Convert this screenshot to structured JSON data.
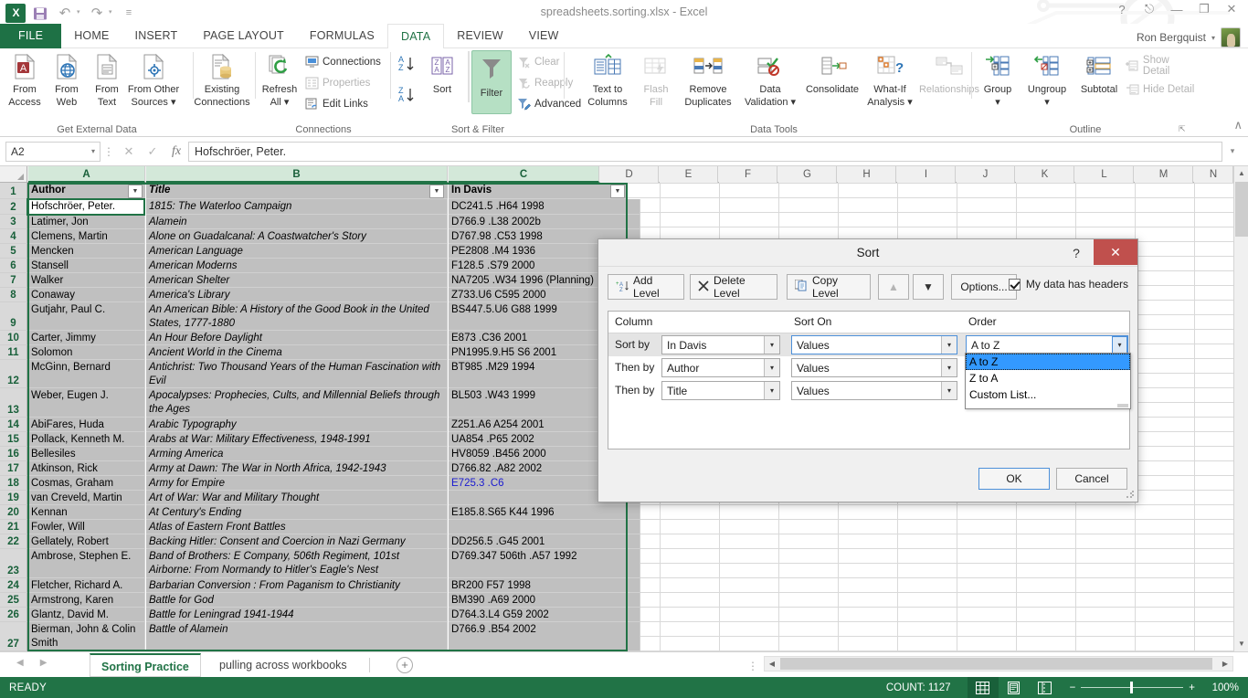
{
  "titlebar": {
    "document_title": "spreadsheets.sorting.xlsx - Excel",
    "logo": "excel-logo",
    "qat": [
      {
        "name": "save",
        "glyph": "💾"
      },
      {
        "name": "undo",
        "glyph": "↶"
      },
      {
        "name": "redo",
        "glyph": "↷"
      },
      {
        "name": "customize",
        "glyph": "≡"
      }
    ],
    "window_controls": [
      {
        "name": "help",
        "glyph": "?"
      },
      {
        "name": "ribbon-display-options",
        "glyph": "⬚"
      },
      {
        "name": "minimize",
        "glyph": "—"
      },
      {
        "name": "restore",
        "glyph": "❐"
      },
      {
        "name": "close",
        "glyph": "✕"
      }
    ],
    "user_name": "Ron Bergquist",
    "user_caret": "▾"
  },
  "tabs": [
    {
      "label": "FILE",
      "active": false,
      "file": true
    },
    {
      "label": "HOME",
      "active": false
    },
    {
      "label": "INSERT",
      "active": false
    },
    {
      "label": "PAGE LAYOUT",
      "active": false
    },
    {
      "label": "FORMULAS",
      "active": false
    },
    {
      "label": "DATA",
      "active": true
    },
    {
      "label": "REVIEW",
      "active": false
    },
    {
      "label": "VIEW",
      "active": false
    }
  ],
  "ribbon": {
    "groups": [
      {
        "name": "get-external-data",
        "label": "Get External Data",
        "big_buttons": [
          {
            "label_line1": "From",
            "label_line2": "Access",
            "icon": "from-access-icon"
          },
          {
            "label_line1": "From",
            "label_line2": "Web",
            "icon": "from-web-icon"
          },
          {
            "label_line1": "From",
            "label_line2": "Text",
            "icon": "from-text-icon"
          },
          {
            "label_line1": "From Other",
            "label_line2": "Sources ▾",
            "icon": "from-other-sources-icon"
          },
          {
            "label_line1": "Existing",
            "label_line2": "Connections",
            "icon": "existing-connections-icon"
          }
        ]
      },
      {
        "name": "connections",
        "label": "Connections",
        "big_buttons": [
          {
            "label_line1": "Refresh",
            "label_line2": "All ▾",
            "icon": "refresh-all-icon"
          }
        ],
        "small_buttons": [
          {
            "label": "Connections",
            "icon": "connections-icon",
            "disabled": false
          },
          {
            "label": "Properties",
            "icon": "properties-icon",
            "disabled": true
          },
          {
            "label": "Edit Links",
            "icon": "edit-links-icon",
            "disabled": true
          }
        ]
      },
      {
        "name": "sort-and-filter",
        "label": "Sort & Filter",
        "big_buttons": [
          {
            "label_line1": "",
            "label_line2": "Sort",
            "icon": "sort-za-icon"
          },
          {
            "label_line1": "",
            "label_line2": "Filter",
            "icon": "filter-icon",
            "active": true
          }
        ],
        "small_buttons": [
          {
            "label": "Clear",
            "icon": "clear-filter-icon",
            "disabled": true
          },
          {
            "label": "Reapply",
            "icon": "reapply-icon",
            "disabled": true
          },
          {
            "label": "Advanced",
            "icon": "advanced-filter-icon",
            "disabled": false
          }
        ],
        "mini_buttons": [
          {
            "name": "sort-az-icon",
            "label": "A↓Z"
          },
          {
            "name": "sort-za-icon",
            "label": "Z↓A"
          }
        ]
      },
      {
        "name": "data-tools",
        "label": "Data Tools",
        "big_buttons": [
          {
            "label_line1": "Text to",
            "label_line2": "Columns",
            "icon": "text-to-columns-icon"
          },
          {
            "label_line1": "Flash",
            "label_line2": "Fill",
            "icon": "flash-fill-icon",
            "disabled": true
          },
          {
            "label_line1": "Remove",
            "label_line2": "Duplicates",
            "icon": "remove-duplicates-icon"
          },
          {
            "label_line1": "Data",
            "label_line2": "Validation ▾",
            "icon": "data-validation-icon"
          },
          {
            "label_line1": "",
            "label_line2": "Consolidate",
            "icon": "consolidate-icon"
          },
          {
            "label_line1": "What-If",
            "label_line2": "Analysis ▾",
            "icon": "what-if-analysis-icon"
          },
          {
            "label_line1": "",
            "label_line2": "Relationships",
            "icon": "relationships-icon",
            "disabled": true
          }
        ]
      },
      {
        "name": "outline",
        "label": "Outline",
        "big_buttons": [
          {
            "label_line1": "Group",
            "label_line2": "▾",
            "icon": "group-icon"
          },
          {
            "label_line1": "Ungroup",
            "label_line2": "▾",
            "icon": "ungroup-icon"
          },
          {
            "label_line1": "",
            "label_line2": "Subtotal",
            "icon": "subtotal-icon"
          }
        ],
        "small_buttons": [
          {
            "label": "Show Detail",
            "icon": "show-detail-icon",
            "disabled": true
          },
          {
            "label": "Hide Detail",
            "icon": "hide-detail-icon",
            "disabled": true
          }
        ]
      }
    ],
    "collapse_glyph": "∧"
  },
  "formula_bar": {
    "name_box_value": "A2",
    "name_box_caret": "▾",
    "cancel_glyph": "✕",
    "enter_glyph": "✓",
    "fx_glyph": "fx",
    "formula_value": "Hofschröer, Peter.",
    "expand_glyph": "▾"
  },
  "grid": {
    "column_headers": [
      "A",
      "B",
      "C",
      "D",
      "E",
      "F",
      "G",
      "H",
      "I",
      "J",
      "K",
      "L",
      "M",
      "N"
    ],
    "selected_columns": [
      "A",
      "B",
      "C"
    ],
    "row_numbers": [
      1,
      2,
      3,
      4,
      5,
      6,
      7,
      8,
      9,
      10,
      11,
      12,
      13,
      14,
      15,
      16,
      17,
      18,
      19,
      20,
      21,
      22,
      23,
      24,
      25,
      26,
      27
    ],
    "headers": {
      "a": "Author",
      "b": "Title",
      "c": "In Davis"
    },
    "rows": [
      {
        "row": 2,
        "author": "Hofschröer, Peter.",
        "title": "1815: The Waterloo Campaign",
        "davis": "DC241.5 .H64 1998",
        "tall": false
      },
      {
        "row": 3,
        "author": "Latimer, Jon",
        "title": "Alamein",
        "davis": "D766.9 .L38 2002b",
        "tall": false
      },
      {
        "row": 4,
        "author": "Clemens, Martin",
        "title": "Alone on Guadalcanal: A Coastwatcher's Story",
        "davis": "D767.98 .C53 1998",
        "tall": false
      },
      {
        "row": 5,
        "author": "Mencken",
        "title": "American Language",
        "davis": "PE2808 .M4 1936",
        "tall": false
      },
      {
        "row": 6,
        "author": "Stansell",
        "title": "American Moderns",
        "davis": "F128.5 .S79 2000",
        "tall": false
      },
      {
        "row": 7,
        "author": "Walker",
        "title": "American Shelter",
        "davis": "NA7205 .W34 1996 (Planning)",
        "tall": false
      },
      {
        "row": 8,
        "author": "Conaway",
        "title": "America's Library",
        "davis": "Z733.U6 C595 2000",
        "tall": false
      },
      {
        "row": 9,
        "author": "Gutjahr, Paul C.",
        "title": "An American Bible: A History of the Good Book in the United States, 1777-1880",
        "davis": "BS447.5.U6 G88 1999",
        "tall": true
      },
      {
        "row": 10,
        "author": "Carter, Jimmy",
        "title": "An Hour Before Daylight",
        "davis": "E873 .C36 2001",
        "tall": false
      },
      {
        "row": 11,
        "author": "Solomon",
        "title": "Ancient World in the Cinema",
        "davis": "PN1995.9.H5 S6 2001",
        "tall": false
      },
      {
        "row": 12,
        "author": "McGinn, Bernard",
        "title": "Antichrist: Two Thousand Years of the Human Fascination with Evil",
        "davis": "BT985 .M29 1994",
        "tall": true
      },
      {
        "row": 13,
        "author": "Weber, Eugen J.",
        "title": "Apocalypses: Prophecies, Cults, and Millennial Beliefs through the Ages",
        "davis": "BL503 .W43 1999",
        "tall": true
      },
      {
        "row": 14,
        "author": "AbiFares, Huda",
        "title": "Arabic Typography",
        "davis": "Z251.A6 A254 2001",
        "tall": false
      },
      {
        "row": 15,
        "author": "Pollack, Kenneth M.",
        "title": "Arabs at War: Military Effectiveness, 1948-1991",
        "davis": "UA854 .P65 2002",
        "tall": false
      },
      {
        "row": 16,
        "author": "Bellesiles",
        "title": "Arming America",
        "davis": "HV8059 .B456 2000",
        "tall": false
      },
      {
        "row": 17,
        "author": "Atkinson, Rick",
        "title": "Army at Dawn: The War in North Africa, 1942-1943",
        "davis": "D766.82 .A82 2002",
        "tall": false
      },
      {
        "row": 18,
        "author": "Cosmas, Graham",
        "title": "Army for Empire",
        "davis": "E725.3 .C6",
        "tall": false,
        "davis_blue": true
      },
      {
        "row": 19,
        "author": "van Creveld, Martin",
        "title": "Art of War: War and Military Thought",
        "davis": "",
        "tall": false
      },
      {
        "row": 20,
        "author": "Kennan",
        "title": "At Century's Ending",
        "davis": "E185.8.S65 K44 1996",
        "tall": false
      },
      {
        "row": 21,
        "author": "Fowler, Will",
        "title": "Atlas of Eastern Front Battles",
        "davis": "",
        "tall": false
      },
      {
        "row": 22,
        "author": "Gellately, Robert",
        "title": "Backing Hitler: Consent and Coercion in Nazi Germany",
        "davis": "DD256.5 .G45 2001",
        "tall": false
      },
      {
        "row": 23,
        "author": "Ambrose, Stephen E.",
        "title": "Band of Brothers: E Company, 506th Regiment, 101st Airborne: From Normandy to Hitler's Eagle's Nest",
        "davis": "D769.347 506th .A57 1992",
        "tall": true
      },
      {
        "row": 24,
        "author": "Fletcher, Richard A.",
        "title": "Barbarian Conversion : From Paganism to Christianity",
        "davis": "BR200 F57 1998",
        "tall": false
      },
      {
        "row": 25,
        "author": "Armstrong, Karen",
        "title": "Battle for God",
        "davis": "BM390 .A69 2000",
        "tall": false
      },
      {
        "row": 26,
        "author": "Glantz, David M.",
        "title": "Battle for Leningrad 1941-1944",
        "davis": "D764.3.L4 G59 2002",
        "tall": false
      },
      {
        "row": 27,
        "author": "Bierman, John & Colin Smith",
        "title": "Battle of Alamein",
        "davis": "D766.9 .B54 2002",
        "tall": true
      }
    ],
    "filter_glyph": "▼",
    "scroll_up_glyph": "▲",
    "scroll_down_glyph": "▼"
  },
  "sort_dialog": {
    "title": "Sort",
    "help_glyph": "?",
    "close_glyph": "✕",
    "toolbar": {
      "add_level": "Add Level",
      "delete_level": "Delete Level",
      "copy_level": "Copy Level",
      "move_up_glyph": "▲",
      "move_down_glyph": "▼",
      "options": "Options...",
      "headers_checkbox_label": "My data has headers",
      "headers_checked": true
    },
    "grid_headers": {
      "column": "Column",
      "sort_on": "Sort On",
      "order": "Order"
    },
    "levels": [
      {
        "label": "Sort by",
        "column": "In Davis",
        "sort_on": "Values",
        "order": "A to Z"
      },
      {
        "label": "Then by",
        "column": "Author",
        "sort_on": "Values",
        "order": "A to Z"
      },
      {
        "label": "Then by",
        "column": "Title",
        "sort_on": "Values",
        "order": "A to Z"
      }
    ],
    "order_dropdown": {
      "open": true,
      "options": [
        "A to Z",
        "Z to A",
        "Custom List..."
      ],
      "selected": "A to Z"
    },
    "combo_arrow_glyph": "▾",
    "ok": "OK",
    "cancel": "Cancel"
  },
  "sheet_tabs": {
    "nav_prev": "◀",
    "nav_next": "▶",
    "tabs": [
      {
        "label": "Sorting Practice",
        "active": true
      },
      {
        "label": "pulling across workbooks",
        "active": false
      }
    ],
    "add_sheet_glyph": "⊕",
    "scroll_left_glyph": "◀",
    "scroll_right_glyph": "▶"
  },
  "status_bar": {
    "mode": "READY",
    "count_label": "COUNT: 1127",
    "views": [
      {
        "name": "normal-view",
        "glyph": "▦",
        "active": true
      },
      {
        "name": "page-layout-view",
        "glyph": "▤",
        "active": false
      },
      {
        "name": "page-break-preview",
        "glyph": "◫",
        "active": false
      }
    ],
    "zoom_out_glyph": "−",
    "zoom_in_glyph": "+",
    "zoom_level": "100%"
  },
  "colors": {
    "excel_green": "#217346",
    "dark_green": "#19603a",
    "filter_active": "#b6e0c4",
    "dialog_close_red": "#c0504d",
    "dropdown_highlight": "#3399ff",
    "cell_fill": "#c0c0c0",
    "link_blue": "#1a1ad0"
  }
}
